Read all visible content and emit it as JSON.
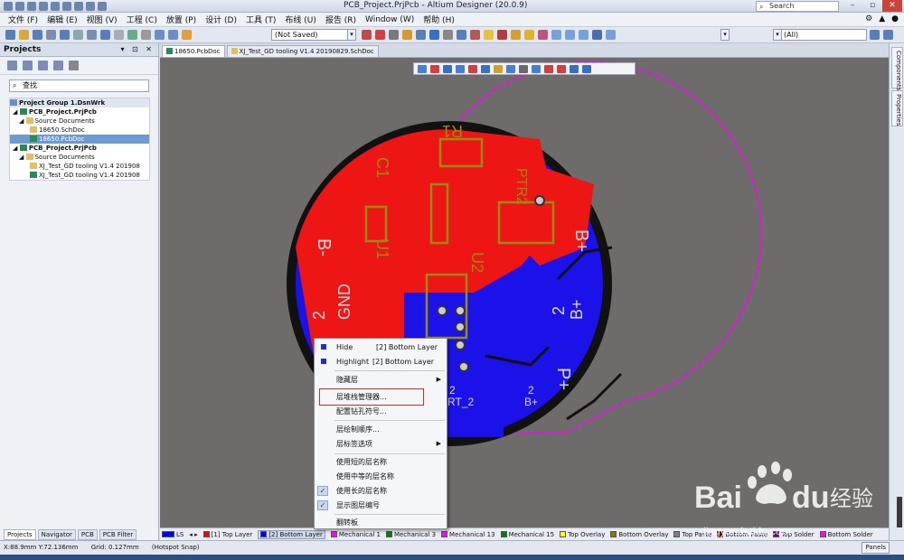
{
  "window": {
    "title": "PCB_Project.PrjPcb - Altium Designer (20.0.9)",
    "search_placeholder": "Search"
  },
  "menu": [
    "文件 (F)",
    "编辑 (E)",
    "视图 (V)",
    "工程 (C)",
    "放置 (P)",
    "设计 (D)",
    "工具 (T)",
    "布线 (U)",
    "报告 (R)",
    "Window (W)",
    "帮助 (H)"
  ],
  "toolbar": {
    "saved_state": "(Not Saved)",
    "filter_value": "(All)"
  },
  "projects_panel": {
    "title": "Projects",
    "search_placeholder": "查找",
    "tree": [
      {
        "label": "Project Group 1.DsnWrk",
        "kind": "group"
      },
      {
        "label": "PCB_Project.PrjPcb",
        "kind": "proj"
      },
      {
        "label": "Source Documents",
        "kind": "folder"
      },
      {
        "label": "18650.SchDoc",
        "kind": "doc"
      },
      {
        "label": "18650.PcbDoc",
        "kind": "doc",
        "selected": true
      },
      {
        "label": "PCB_Project.PrjPcb",
        "kind": "proj"
      },
      {
        "label": "Source Documents",
        "kind": "folder"
      },
      {
        "label": "XJ_Test_GD tooling V1.4 201908",
        "kind": "doc"
      },
      {
        "label": "XJ_Test_GD tooling V1.4 201908",
        "kind": "doc"
      }
    ],
    "bottom_tabs": [
      "Projects",
      "Navigator",
      "PCB",
      "PCB Filter"
    ]
  },
  "doc_tabs": [
    "18650.PcbDoc",
    "XJ_Test_GD tooling V1.4 20190829.SchDoc"
  ],
  "right_tabs": [
    "Components",
    "Properties"
  ],
  "pcb_labels": {
    "r1": "R1",
    "c1": "C1",
    "u1": "U1",
    "u2": "U2",
    "ptr2": "PTR2",
    "bminus": "B-",
    "bplus": "B+",
    "gnd": "GND",
    "two_gnd": "2",
    "two_b": "2",
    "bplus2": "B+",
    "pplus": "P+",
    "rt2": "RT_2",
    "two_rt": "2",
    "bplus3": "B+",
    "two_b3": "2"
  },
  "context_menu": [
    {
      "label": "Hide",
      "extra": "[2] Bottom Layer",
      "marker": "swatch"
    },
    {
      "label": "Highlight",
      "extra": "[2] Bottom Layer",
      "marker": "swatch"
    },
    {
      "label": "隐藏层",
      "submenu": true
    },
    {
      "label": "层堆栈管理器..."
    },
    {
      "label": "配置钻孔符号..."
    },
    {
      "label": "层绘制顺序..."
    },
    {
      "label": "层标签选项",
      "submenu": true
    },
    {
      "label": "使用短的层名称"
    },
    {
      "label": "使用中等的层名称"
    },
    {
      "label": "使用长的层名称",
      "checked": true
    },
    {
      "label": "显示图层编号",
      "checked": true
    },
    {
      "label": "翻转板"
    }
  ],
  "layer_tabs": [
    {
      "label": "LS",
      "color": "#0000ff"
    },
    {
      "label": "[1] Top Layer",
      "color": "#ff0000"
    },
    {
      "label": "[2] Bottom Layer",
      "color": "#0000ff",
      "active": true
    },
    {
      "label": "Mechanical 1",
      "color": "#ff00ff"
    },
    {
      "label": "Mechanical 3",
      "color": "#008000"
    },
    {
      "label": "Mechanical 13",
      "color": "#ff00ff"
    },
    {
      "label": "Mechanical 15",
      "color": "#008000"
    },
    {
      "label": "Top Overlay",
      "color": "#ffff00"
    },
    {
      "label": "Bottom Overlay",
      "color": "#808000"
    },
    {
      "label": "Top Paste",
      "color": "#808080"
    },
    {
      "label": "Bottom Paste",
      "color": "#800000"
    },
    {
      "label": "Top Solder",
      "color": "#800080"
    },
    {
      "label": "Bottom Solder",
      "color": "#ff00ff"
    }
  ],
  "status": {
    "coords": "X:88.9mm Y:72.136mm",
    "grid": "Grid: 0.127mm",
    "snap": "(Hotspot Snap)",
    "panels": "Panels"
  },
  "watermark": {
    "brand": "Bai",
    "brand2": "du",
    "cn": "经验",
    "url": "jingyan.baidu.com"
  }
}
